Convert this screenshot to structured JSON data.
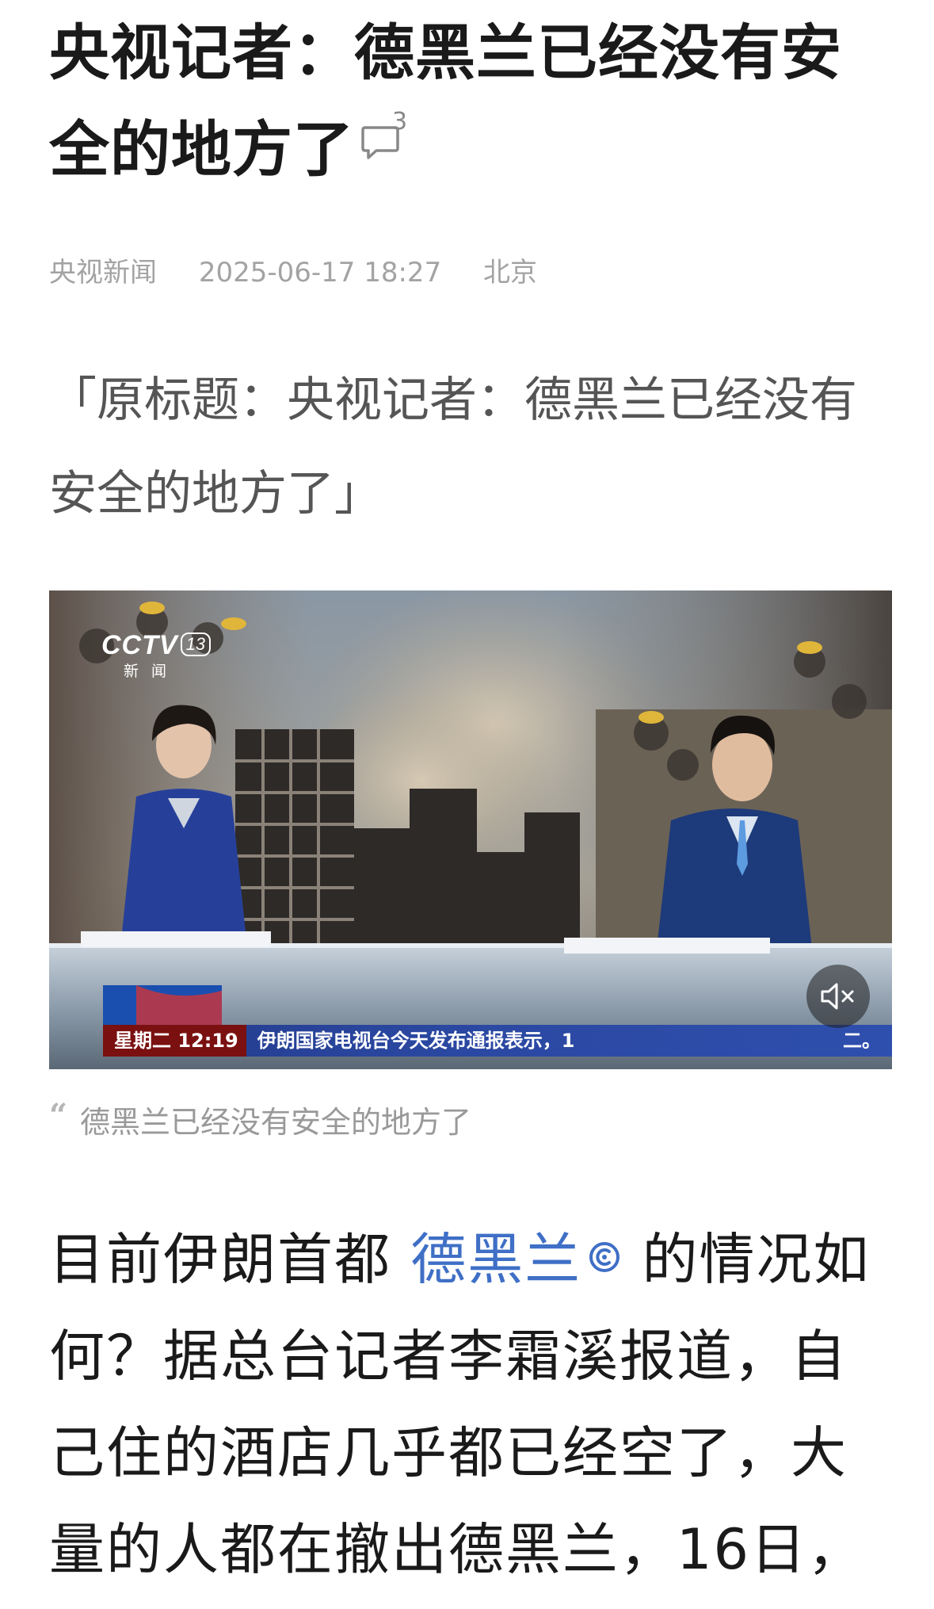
{
  "article": {
    "title": "央视记者：德黑兰已经没有安全的地方了",
    "comment_count": "3",
    "source": "央视新闻",
    "datetime": "2025-06-17 18:27",
    "location": "北京",
    "original_title": "「原标题：央视记者：德黑兰已经没有安全的地方了」"
  },
  "video": {
    "channel_logo": "CCTV",
    "channel_number": "13",
    "channel_sub": "新闻",
    "ticker_day_time": "星期二 12:19",
    "ticker_text": "伊朗国家电视台今天发布通报表示，1",
    "ticker_end": "二。",
    "caption": "德黑兰已经没有安全的地方了",
    "mute_icon": "speaker-muted-icon"
  },
  "body": {
    "text_before_link": "目前伊朗首都",
    "link_text": "德黑兰",
    "link_icon": "entity-search-icon",
    "text_after_link": "的情况如何？据总台记者李霜溪报道，自己住的酒店几乎都已经空了，大量的人都在撤出德黑兰，16日，"
  },
  "colors": {
    "link": "#3f6fc6",
    "meta": "#a3a3a3",
    "ticker_blue": "#2a47a0",
    "ticker_red": "#7a1010"
  }
}
